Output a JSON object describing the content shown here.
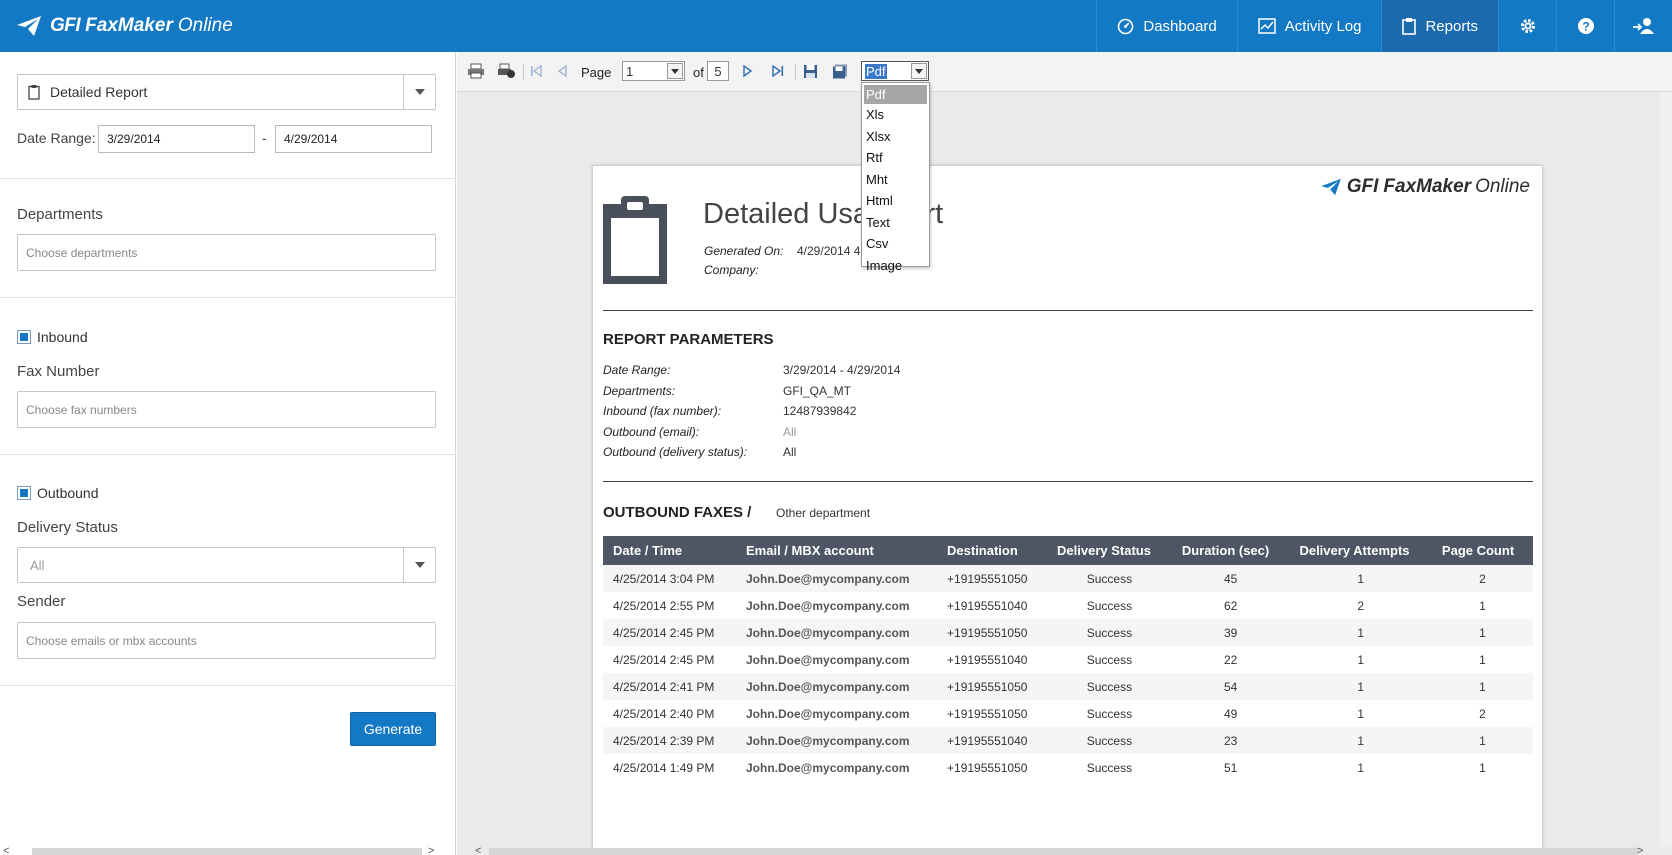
{
  "app": {
    "brand_gfi": "GFI",
    "brand_name": "FaxMaker",
    "brand_suffix": "Online"
  },
  "nav": {
    "dashboard": "Dashboard",
    "activity_log": "Activity Log",
    "reports": "Reports"
  },
  "left": {
    "report_type": "Detailed Report",
    "date_range_label": "Date Range:",
    "date_from": "3/29/2014",
    "date_sep": "-",
    "date_to": "4/29/2014",
    "departments_label": "Departments",
    "departments_placeholder": "Choose departments",
    "inbound_label": "Inbound",
    "inbound_checked": true,
    "fax_number_label": "Fax Number",
    "fax_number_placeholder": "Choose fax numbers",
    "outbound_label": "Outbound",
    "outbound_checked": true,
    "delivery_status_label": "Delivery Status",
    "delivery_status_value": "All",
    "sender_label": "Sender",
    "sender_placeholder": "Choose emails or mbx accounts",
    "generate_label": "Generate"
  },
  "toolbar": {
    "page_label": "Page",
    "page_value": "1",
    "of_label": "of",
    "page_total": "5",
    "format_value": "Pdf",
    "format_options": [
      "Pdf",
      "Xls",
      "Xlsx",
      "Rtf",
      "Mht",
      "Html",
      "Text",
      "Csv",
      "Image"
    ]
  },
  "report": {
    "title": "Detailed Usa  eport",
    "generated_on_label": "Generated On:",
    "generated_on_value": "4/29/2014 4",
    "company_label": "Company:",
    "params_title": "REPORT PARAMETERS",
    "params": [
      {
        "label": "Date Range:",
        "value": "3/29/2014 - 4/29/2014",
        "grey": false
      },
      {
        "label": "Departments:",
        "value": "GFI_QA_MT",
        "grey": false
      },
      {
        "label": "Inbound (fax number):",
        "value": "12487939842",
        "grey": false
      },
      {
        "label": "Outbound (email):",
        "value": "All",
        "grey": true
      },
      {
        "label": "Outbound (delivery status):",
        "value": "All",
        "grey": false
      }
    ],
    "outbound_title": "OUTBOUND FAXES /",
    "outbound_department": "Other department",
    "columns": [
      "Date / Time",
      "Email / MBX account",
      "Destination",
      "Delivery Status",
      "Duration (sec)",
      "Delivery Attempts",
      "Page Count"
    ],
    "rows": [
      [
        "4/25/2014 3:04 PM",
        "John.Doe@mycompany.com",
        "+19195551050",
        "Success",
        "45",
        "1",
        "2"
      ],
      [
        "4/25/2014 2:55 PM",
        "John.Doe@mycompany.com",
        "+19195551040",
        "Success",
        "62",
        "2",
        "1"
      ],
      [
        "4/25/2014 2:45 PM",
        "John.Doe@mycompany.com",
        "+19195551050",
        "Success",
        "39",
        "1",
        "1"
      ],
      [
        "4/25/2014 2:45 PM",
        "John.Doe@mycompany.com",
        "+19195551040",
        "Success",
        "22",
        "1",
        "1"
      ],
      [
        "4/25/2014 2:41 PM",
        "John.Doe@mycompany.com",
        "+19195551050",
        "Success",
        "54",
        "1",
        "1"
      ],
      [
        "4/25/2014 2:40 PM",
        "John.Doe@mycompany.com",
        "+19195551050",
        "Success",
        "49",
        "1",
        "2"
      ],
      [
        "4/25/2014 2:39 PM",
        "John.Doe@mycompany.com",
        "+19195551040",
        "Success",
        "23",
        "1",
        "1"
      ],
      [
        "4/25/2014 1:49 PM",
        "John.Doe@mycompany.com",
        "+19195551050",
        "Success",
        "51",
        "1",
        "1"
      ]
    ]
  },
  "colors": {
    "brand_blue": "#1379c4",
    "table_header": "#4e5564"
  }
}
